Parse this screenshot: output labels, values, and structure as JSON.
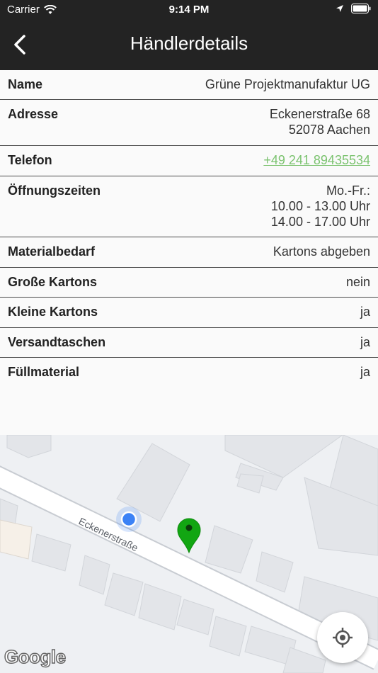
{
  "status": {
    "carrier": "Carrier",
    "time": "9:14 PM"
  },
  "nav": {
    "title": "Händlerdetails"
  },
  "details": {
    "name_label": "Name",
    "name_value": "Grüne Projektmanufaktur UG",
    "address_label": "Adresse",
    "address_line1": "Eckenerstraße 68",
    "address_line2": "52078 Aachen",
    "phone_label": "Telefon",
    "phone_value": "+49 241 89435534",
    "hours_label": "Öffnungszeiten",
    "hours_line1": "Mo.-Fr.:",
    "hours_line2": "10.00 - 13.00 Uhr",
    "hours_line3": "14.00 - 17.00 Uhr",
    "material_label": "Materialbedarf",
    "material_value": "Kartons abgeben",
    "large_boxes_label": "Große Kartons",
    "large_boxes_value": "nein",
    "small_boxes_label": "Kleine Kartons",
    "small_boxes_value": "ja",
    "mailer_bags_label": "Versandtaschen",
    "mailer_bags_value": "ja",
    "filler_label": "Füllmaterial",
    "filler_value": "ja"
  },
  "map": {
    "street_label": "Eckenerstraße",
    "logo": "Google",
    "pin_color": "#12a612",
    "user_dot_color": "#3b82f6"
  },
  "icons": {
    "back": "chevron-left-icon",
    "wifi": "wifi-icon",
    "location_arrow": "location-arrow-icon",
    "battery": "battery-icon",
    "locate": "my-location-icon"
  }
}
